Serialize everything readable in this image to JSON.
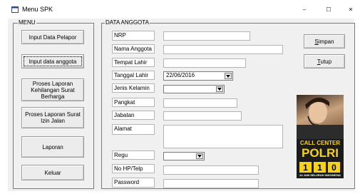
{
  "window": {
    "title": "Menu SPK",
    "controls": {
      "minimize": "–",
      "maximize": "☐",
      "close": "✕"
    }
  },
  "menu": {
    "title": "MENU",
    "buttons": [
      {
        "label": "Input Data Pelapor"
      },
      {
        "label": "Input data anggota"
      },
      {
        "label": "Proses Laporan Kehilangan Surat Berharga"
      },
      {
        "label": "Proses Laporan Surat Izin Jalan"
      },
      {
        "label": "Laporan"
      },
      {
        "label": "Keluar"
      }
    ]
  },
  "form": {
    "title": "DATA ANGGOTA",
    "fields": [
      {
        "label": "NRP",
        "value": ""
      },
      {
        "label": "Nama Anggota",
        "value": ""
      },
      {
        "label": "Tempat Lahir",
        "value": ""
      },
      {
        "label": "Tanggal Lahir",
        "value": "22/06/2016"
      },
      {
        "label": "Jenis Kelamin",
        "value": ""
      },
      {
        "label": "Pangkat",
        "value": ""
      },
      {
        "label": "Jabatan",
        "value": ""
      },
      {
        "label": "Alamat",
        "value": ""
      },
      {
        "label": "Regu",
        "value": ""
      },
      {
        "label": "No HP/Telp",
        "value": ""
      },
      {
        "label": "Password",
        "value": ""
      }
    ],
    "simpan_first": "S",
    "simpan_rest": "impan",
    "tutup_first": "T",
    "tutup_rest": "utup"
  },
  "poster": {
    "line1": "CALL CENTER",
    "line2": "POLRI",
    "digits": [
      "1",
      "1",
      "0"
    ],
    "tagline": "24 JAM SELURUH INDONESIA"
  },
  "colors": {
    "poster_yellow": "#f7d21a",
    "poster_bg": "#1b1b1b"
  }
}
